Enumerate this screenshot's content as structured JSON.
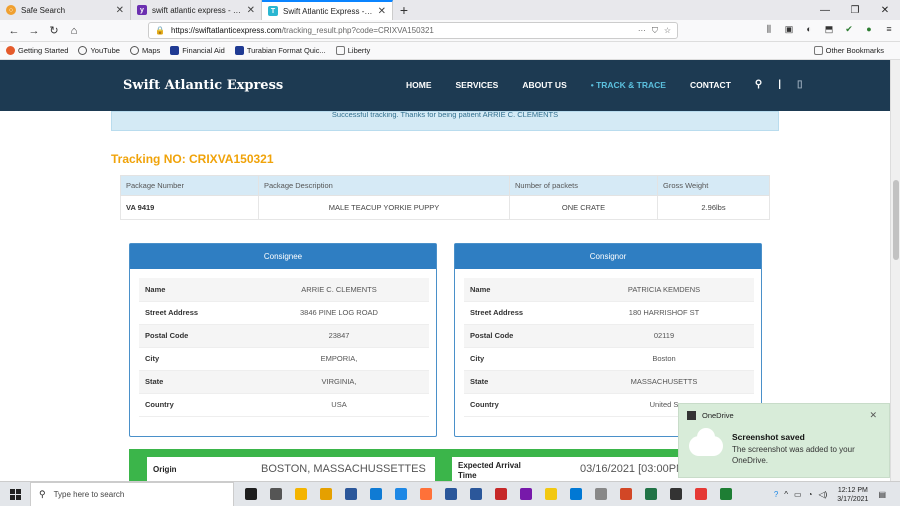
{
  "browser": {
    "tabs": [
      {
        "label": "Safe Search",
        "color": "#f0a030",
        "glyph": "○"
      },
      {
        "label": "swift atlantic express - safesea",
        "color": "#6b2fb0",
        "glyph": "y"
      },
      {
        "label": "Swift Atlantic Express - Secure",
        "color": "#29b6d1",
        "glyph": "T",
        "active": true
      }
    ],
    "url_host": "https://swiftatlanticexpress.com",
    "url_path": "/tracking_result.php?code=CRIXVA150321",
    "bookmarks": [
      {
        "label": "Getting Started",
        "color": "#e55b2b"
      },
      {
        "label": "YouTube",
        "color": "#555555"
      },
      {
        "label": "Maps",
        "color": "#555555"
      },
      {
        "label": "Financial Aid",
        "color": "#1f3a93"
      },
      {
        "label": "Turabian Format Quic...",
        "color": "#1f3a93"
      },
      {
        "label": "Liberty",
        "color": "#999999"
      }
    ],
    "other_bookmarks": "Other Bookmarks"
  },
  "site": {
    "logo": "Swift Atlantic Express",
    "nav": [
      {
        "label": "HOME",
        "active": false
      },
      {
        "label": "SERVICES",
        "active": false
      },
      {
        "label": "ABOUT US",
        "active": false
      },
      {
        "label": "• TRACK & TRACE",
        "active": true
      },
      {
        "label": "CONTACT",
        "active": false
      }
    ]
  },
  "alert": "Successful tracking. Thanks for being patient ARRIE C. CLEMENTS",
  "tracking_no": "Tracking NO: CRIXVA150321",
  "package": {
    "headers": [
      "Package Number",
      "Package Description",
      "Number of packets",
      "Gross Weight"
    ],
    "row": [
      "VA 9419",
      "MALE TEACUP YORKIE PUPPY",
      "ONE CRATE",
      "2.96lbs"
    ]
  },
  "consignee": {
    "title": "Consignee",
    "rows": [
      {
        "k": "Name",
        "v": "ARRIE C. CLEMENTS"
      },
      {
        "k": "Street Address",
        "v": "3846 PINE LOG ROAD"
      },
      {
        "k": "Postal Code",
        "v": "23847"
      },
      {
        "k": "City",
        "v": "EMPORIA,"
      },
      {
        "k": "State",
        "v": "VIRGINIA,"
      },
      {
        "k": "Country",
        "v": "USA"
      }
    ]
  },
  "consignor": {
    "title": "Consignor",
    "rows": [
      {
        "k": "Name",
        "v": "PATRICIA KEMDENS"
      },
      {
        "k": "Street Address",
        "v": "180 HARRISHOF ST"
      },
      {
        "k": "Postal Code",
        "v": "02119"
      },
      {
        "k": "City",
        "v": "Boston"
      },
      {
        "k": "State",
        "v": "MASSACHUSETTS"
      },
      {
        "k": "Country",
        "v": "United S"
      }
    ]
  },
  "shipment": {
    "origin_label": "Origin",
    "origin_value": "BOSTON, MASSACHUSSETTES",
    "expected_label": "Expected Arrival Time",
    "expected_value": "03/16/2021 [03:00PM"
  },
  "toast": {
    "app": "OneDrive",
    "title": "Screenshot saved",
    "body": "The screenshot was added to your OneDrive."
  },
  "taskbar": {
    "search_placeholder": "Type here to search",
    "time": "12:12 PM",
    "date": "3/17/2021",
    "apps": [
      "#1e1e1e",
      "#555",
      "#f4b400",
      "#e5a000",
      "#2b579a",
      "#0f7bd4",
      "#1e88e5",
      "#ff7139",
      "#2b579a",
      "#2b579a",
      "#c62828",
      "#7719aa",
      "#f2c811",
      "#0078d4",
      "#888",
      "#d24726",
      "#217346",
      "#333",
      "#e53935",
      "#1e7e34"
    ]
  }
}
